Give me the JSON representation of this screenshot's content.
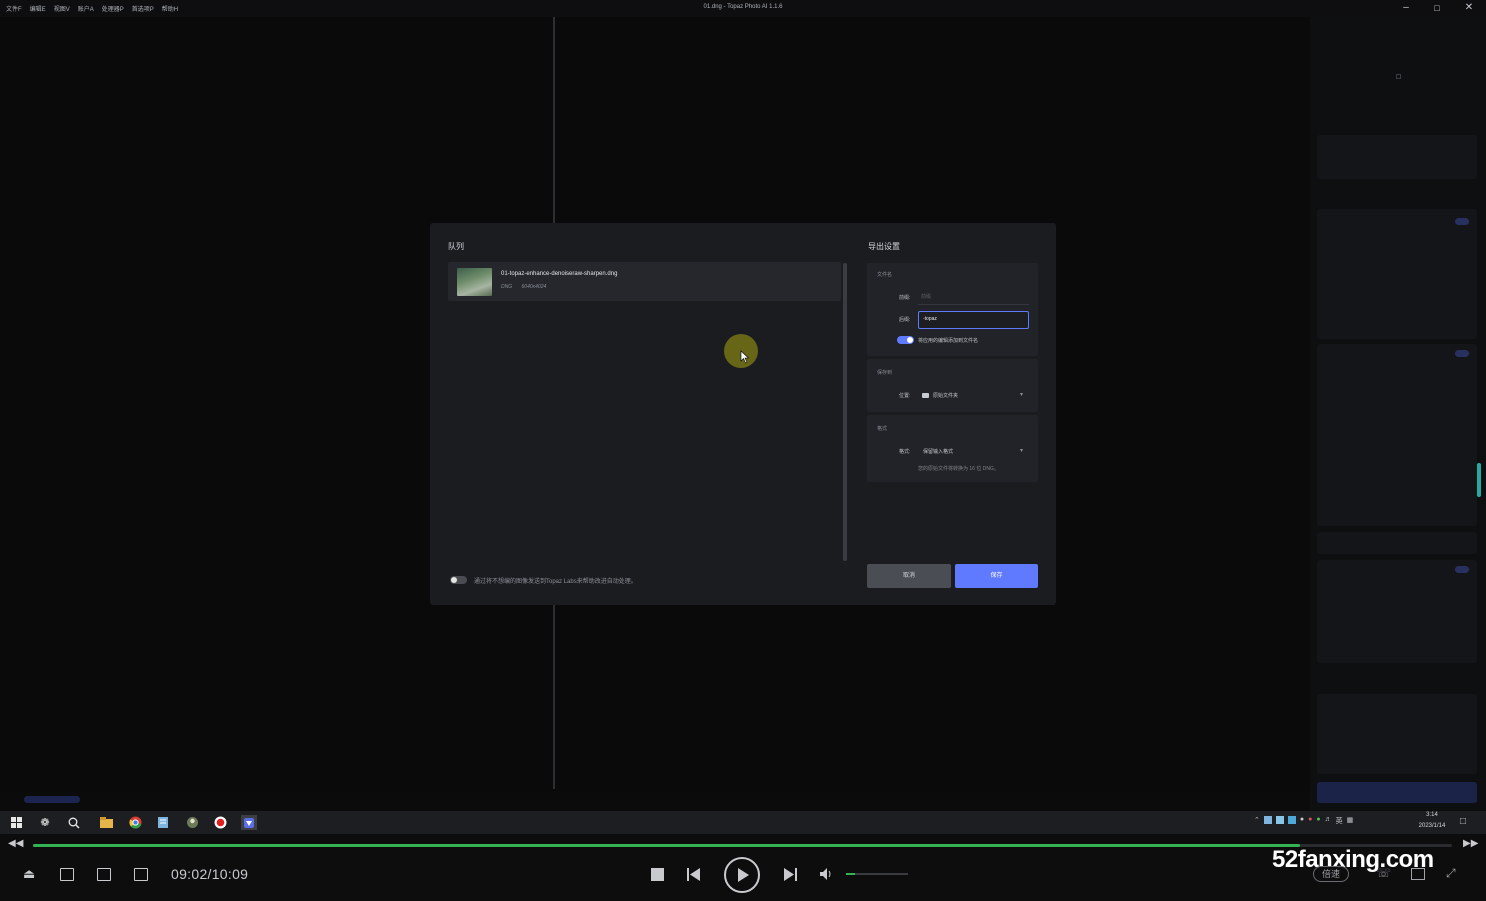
{
  "titlebar": {
    "menu": [
      "文件F",
      "编辑E",
      "视图V",
      "账户A",
      "处理器P",
      "首选项P",
      "帮助H"
    ],
    "title": "01.dng - Topaz Photo AI 1.1.6",
    "minimize_icon": "minimize-icon",
    "maximize_icon": "maximize-icon",
    "close_icon": "close-icon"
  },
  "modal": {
    "queue_title": "队列",
    "queue_items": [
      {
        "filename": "01-topaz-enhance-denoiseraw-sharpen.dng",
        "format": "DNG",
        "dimensions": "6040x4024"
      }
    ],
    "auto_toggle_text": "通过将不想编的图像发送到Topaz Labs来帮助改进自动处理。",
    "export_title": "导出设置",
    "filename_card": {
      "title": "文件名",
      "prefix_label": "前缀:",
      "prefix_placeholder": "前缀",
      "suffix_label": "后缀:",
      "suffix_value": "-topaz",
      "apply_label": "将应用的编辑添加到文件名",
      "apply_enabled": true
    },
    "saveto_card": {
      "title": "保存到",
      "location_label": "位置:",
      "location_value": "原始文件夹",
      "folder_icon": "folder-icon"
    },
    "format_card": {
      "title": "格式",
      "format_label": "格式:",
      "format_value": "保留输入格式",
      "note": "您的原始文件将转换为 16 位 DNG。"
    },
    "cancel_label": "取消",
    "save_label": "保存"
  },
  "taskbar": {
    "apps": [
      "start-icon",
      "fan-icon",
      "search-icon",
      "file-explorer-icon",
      "chrome-icon",
      "notepad-icon",
      "app-icon",
      "record-icon",
      "topaz-icon"
    ],
    "tray_lang": "英",
    "clock_time": "3:14",
    "clock_date": "2023/1/14"
  },
  "player": {
    "time": "09:02/10:09",
    "progress": 0.893,
    "volume": 0.15,
    "watermark": "52fanxing.com",
    "speed_label": "倍速"
  },
  "colors": {
    "accent": "#5f79ff",
    "modal_bg": "#1b1c20",
    "progress": "#34b354"
  }
}
